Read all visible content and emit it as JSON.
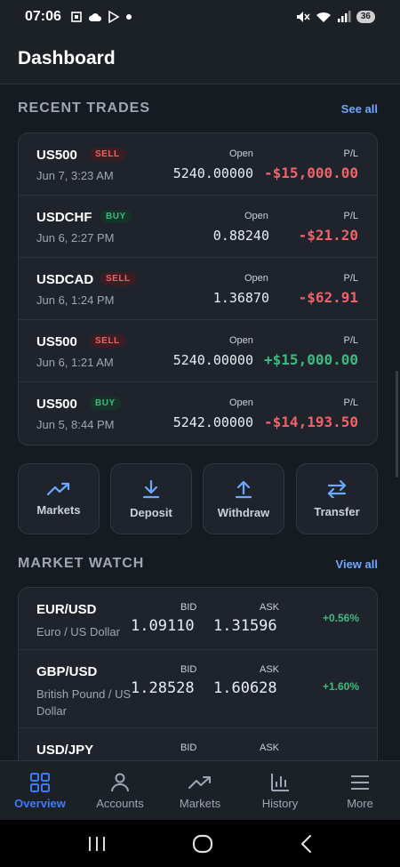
{
  "status": {
    "time": "07:06",
    "battery": "36"
  },
  "header": {
    "title": "Dashboard"
  },
  "recent_trades": {
    "title": "RECENT TRADES",
    "link": "See all",
    "open_label": "Open",
    "pl_label": "P/L",
    "items": [
      {
        "symbol": "US500",
        "side": "SELL",
        "date": "Jun 7, 3:23 AM",
        "open": "5240.00000",
        "pl": "-$15,000.00",
        "pl_sign": "neg"
      },
      {
        "symbol": "USDCHF",
        "side": "BUY",
        "date": "Jun 6, 2:27 PM",
        "open": "0.88240",
        "pl": "-$21.20",
        "pl_sign": "neg"
      },
      {
        "symbol": "USDCAD",
        "side": "SELL",
        "date": "Jun 6, 1:24 PM",
        "open": "1.36870",
        "pl": "-$62.91",
        "pl_sign": "neg"
      },
      {
        "symbol": "US500",
        "side": "SELL",
        "date": "Jun 6, 1:21 AM",
        "open": "5240.00000",
        "pl": "+$15,000.00",
        "pl_sign": "pos"
      },
      {
        "symbol": "US500",
        "side": "BUY",
        "date": "Jun 5, 8:44 PM",
        "open": "5242.00000",
        "pl": "-$14,193.50",
        "pl_sign": "neg"
      }
    ]
  },
  "actions": [
    {
      "label": "Markets",
      "icon": "trending-up-icon"
    },
    {
      "label": "Deposit",
      "icon": "download-icon"
    },
    {
      "label": "Withdraw",
      "icon": "upload-icon"
    },
    {
      "label": "Transfer",
      "icon": "swap-icon"
    }
  ],
  "market_watch": {
    "title": "MARKET WATCH",
    "link": "View all",
    "bid_label": "BID",
    "ask_label": "ASK",
    "items": [
      {
        "pair": "EUR/USD",
        "desc": "Euro / US Dollar",
        "bid": "1.09110",
        "ask": "1.31596",
        "change": "+0.56%"
      },
      {
        "pair": "GBP/USD",
        "desc": "British Pound / US Dollar",
        "bid": "1.28528",
        "ask": "1.60628",
        "change": "+1.60%"
      },
      {
        "pair": "USD/JPY",
        "desc": "",
        "bid": "",
        "ask": "",
        "change": ""
      }
    ]
  },
  "bottom_nav": [
    {
      "label": "Overview",
      "icon": "grid-icon",
      "active": true
    },
    {
      "label": "Accounts",
      "icon": "user-icon",
      "active": false
    },
    {
      "label": "Markets",
      "icon": "trending-up-icon",
      "active": false
    },
    {
      "label": "History",
      "icon": "bar-chart-icon",
      "active": false
    },
    {
      "label": "More",
      "icon": "menu-icon",
      "active": false
    }
  ],
  "colors": {
    "accent": "#3d7bfd",
    "positive": "#3fb97f",
    "negative": "#f0626a"
  }
}
